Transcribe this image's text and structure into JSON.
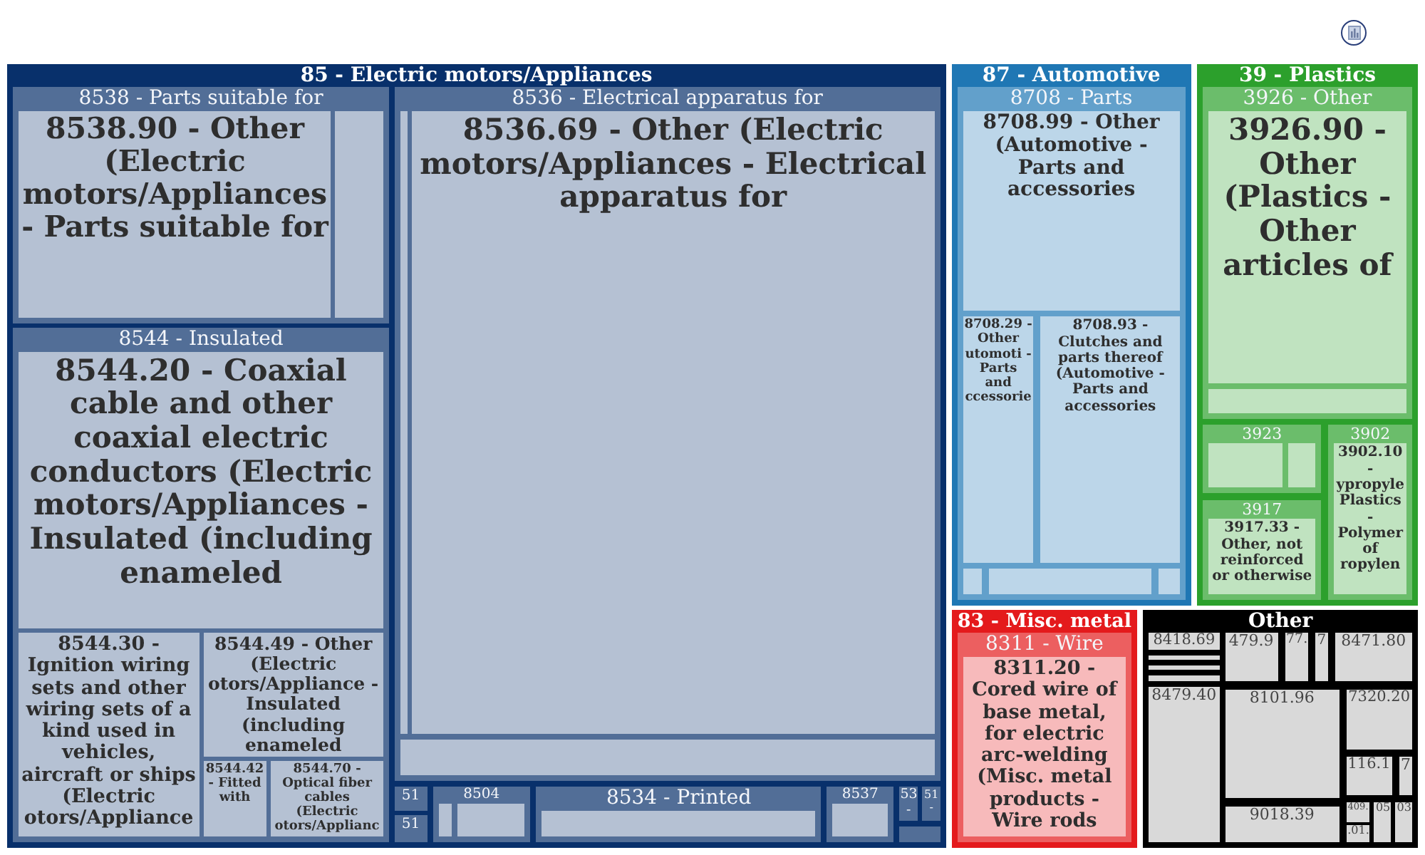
{
  "treemap": {
    "groups": [
      {
        "label": "85 - Electric motors/Appliances",
        "color": "#08306b",
        "children": [
          {
            "kind": "category",
            "label": "8538 - Parts suitable for",
            "children": [
              {
                "kind": "product",
                "label": "8538.90 - Other (Electric motors/Appliances - Parts suitable for"
              },
              {
                "kind": "product"
              }
            ]
          },
          {
            "kind": "category",
            "label": "8544 - Insulated",
            "children": [
              {
                "kind": "product",
                "label": "8544.20 - Coaxial cable and other coaxial electric conductors (Electric motors/Appliances - Insulated (including enameled"
              },
              {
                "kind": "product",
                "label": "8544.30 - Ignition wiring sets and other wiring sets of a kind used in vehicles, aircraft or ships (Electric otors/Appliance"
              },
              {
                "kind": "product",
                "label": "8544.49 - Other (Electric otors/Appliance - Insulated (including enameled"
              },
              {
                "kind": "product",
                "label": "8544.42 - Fitted with"
              },
              {
                "kind": "product",
                "label": "8544.70 - Optical fiber cables (Electric otors/Applianc"
              }
            ]
          },
          {
            "kind": "category",
            "label": "8536 - Electrical apparatus for",
            "children": [
              {
                "kind": "product"
              },
              {
                "kind": "product",
                "label": "8536.69 - Other (Electric motors/Appliances - Electrical apparatus for"
              },
              {
                "kind": "product"
              }
            ]
          },
          {
            "kind": "category",
            "label": "51"
          },
          {
            "kind": "category",
            "label": "51"
          },
          {
            "kind": "category",
            "label": "8504",
            "children": [
              {
                "kind": "product"
              },
              {
                "kind": "product"
              }
            ]
          },
          {
            "kind": "category",
            "label": "8534 - Printed",
            "children": [
              {
                "kind": "product"
              }
            ]
          },
          {
            "kind": "category",
            "label": "8537",
            "children": [
              {
                "kind": "product"
              }
            ]
          },
          {
            "kind": "category",
            "label": "53 -"
          },
          {
            "kind": "category",
            "label": "51 -"
          },
          {
            "kind": "category"
          }
        ]
      },
      {
        "label": "87 - Automotive",
        "color": "#1f77b4",
        "children": [
          {
            "kind": "category",
            "label": "8708 - Parts",
            "children": [
              {
                "kind": "product",
                "label": "8708.99 - Other (Automotive - Parts and accessories"
              },
              {
                "kind": "product",
                "label": "8708.29 - Other utomoti - Parts and ccessorie"
              },
              {
                "kind": "product",
                "label": "8708.93 - Clutches and parts thereof (Automotive - Parts and accessories"
              },
              {
                "kind": "product"
              },
              {
                "kind": "product"
              },
              {
                "kind": "product"
              }
            ]
          }
        ]
      },
      {
        "label": "39 - Plastics",
        "color": "#2ca02c",
        "children": [
          {
            "kind": "category",
            "label": "3926 - Other",
            "children": [
              {
                "kind": "product",
                "label": "3926.90 - Other (Plastics - Other articles of"
              },
              {
                "kind": "product"
              }
            ]
          },
          {
            "kind": "category",
            "label": "3923",
            "children": [
              {
                "kind": "product"
              },
              {
                "kind": "product"
              }
            ]
          },
          {
            "kind": "category",
            "label": "3917",
            "children": [
              {
                "kind": "product",
                "label": "3917.33 - Other, not reinforced or otherwise"
              }
            ]
          },
          {
            "kind": "category",
            "label": "3902",
            "children": [
              {
                "kind": "product",
                "label": "3902.10 - ypropyle Plastics - Polymer of ropylen"
              }
            ]
          }
        ]
      },
      {
        "label": "83 - Misc. metal",
        "color": "#e41a1c",
        "children": [
          {
            "kind": "category",
            "label": "8311 - Wire",
            "children": [
              {
                "kind": "product",
                "label": "8311.20 - Cored wire of base metal, for electric arc-welding (Misc. metal products - Wire rods"
              }
            ]
          }
        ]
      },
      {
        "label": "Other",
        "color": "#000000",
        "children": [
          {
            "kind": "product",
            "label": "8418.69"
          },
          {
            "kind": "product"
          },
          {
            "kind": "product"
          },
          {
            "kind": "product"
          },
          {
            "kind": "product",
            "label": "8479.40"
          },
          {
            "kind": "product",
            "label": "479.9"
          },
          {
            "kind": "product",
            "label": "77."
          },
          {
            "kind": "product",
            "label": "7"
          },
          {
            "kind": "product",
            "label": "8471.80"
          },
          {
            "kind": "product",
            "label": "8101.96"
          },
          {
            "kind": "product",
            "label": "7320.20"
          },
          {
            "kind": "product",
            "label": "116.1"
          },
          {
            "kind": "product",
            "label": "7"
          },
          {
            "kind": "product",
            "label": "9018.39"
          },
          {
            "kind": "product",
            "label": "409."
          },
          {
            "kind": "product",
            "label": ".01."
          },
          {
            "kind": "product",
            "label": "05"
          },
          {
            "kind": "product",
            "label": "03"
          }
        ]
      }
    ]
  }
}
